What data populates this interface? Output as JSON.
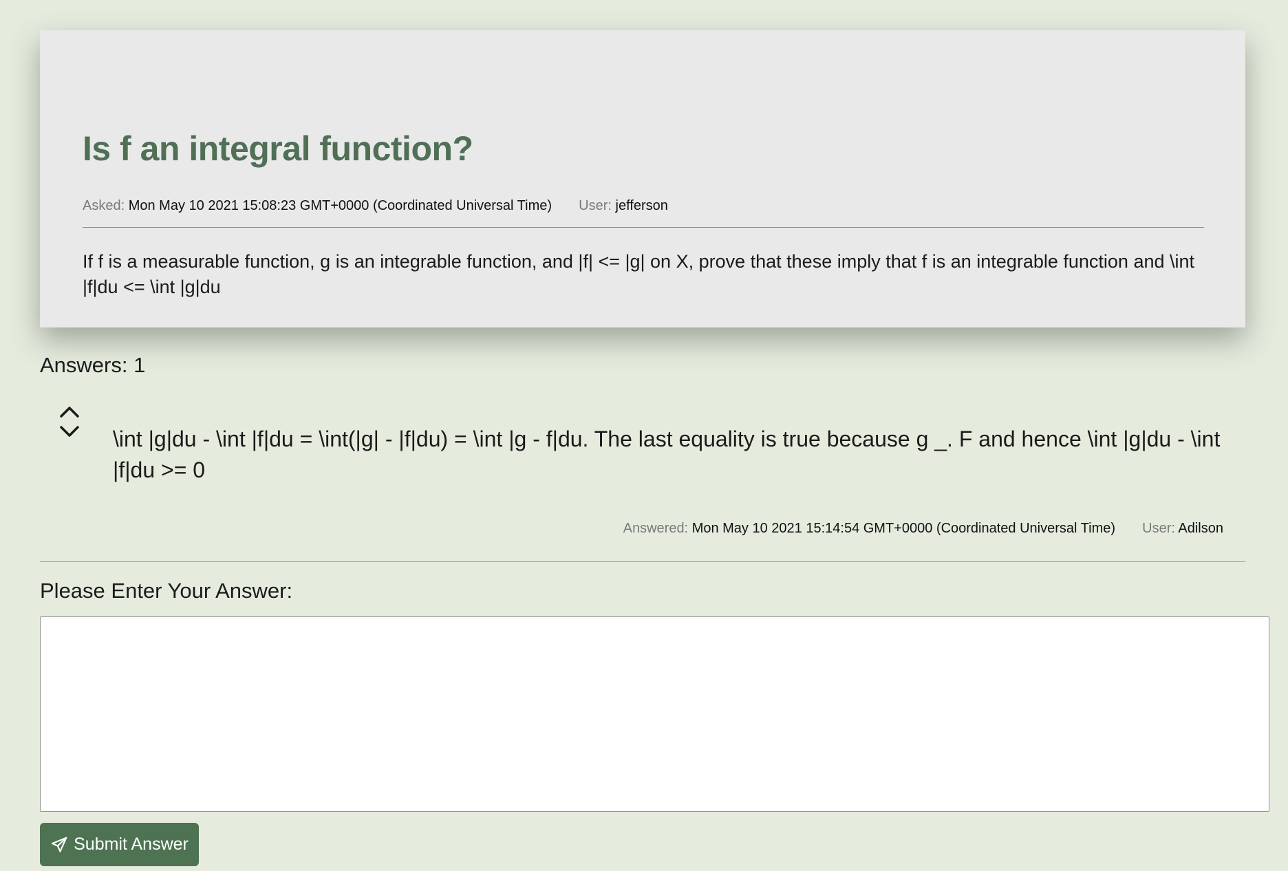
{
  "question": {
    "title": "Is f an integral function?",
    "asked_label": "Asked:",
    "asked_value": "Mon May 10 2021 15:08:23 GMT+0000 (Coordinated Universal Time)",
    "user_label": "User:",
    "user_value": "jefferson",
    "body": "If f is a measurable function, g is an integrable function, and |f| <= |g| on X, prove that these imply that f is an integrable function and \\int |f|du <= \\int |g|du"
  },
  "answers": {
    "count_text": "Answers: 1",
    "items": [
      {
        "body": "\\int |g|du - \\int |f|du = \\int(|g| - |f|du) = \\int |g - f|du. The last equality is true because g _. F and hence \\int |g|du - \\int |f|du >= 0",
        "answered_label": "Answered:",
        "answered_value": "Mon May 10 2021 15:14:54 GMT+0000 (Coordinated Universal Time)",
        "user_label": "User:",
        "user_value": "Adilson",
        "vote_up_icon": "chevron-up-icon",
        "vote_down_icon": "chevron-down-icon"
      }
    ]
  },
  "answer_form": {
    "prompt": "Please Enter Your Answer:",
    "textarea_value": "",
    "submit_label": "Submit Answer",
    "submit_icon": "paper-plane-icon"
  },
  "colors": {
    "page_background": "#e5ecde",
    "card_background": "#e9e9e9",
    "title_color": "#4f6f57",
    "button_background": "#4d7353"
  }
}
